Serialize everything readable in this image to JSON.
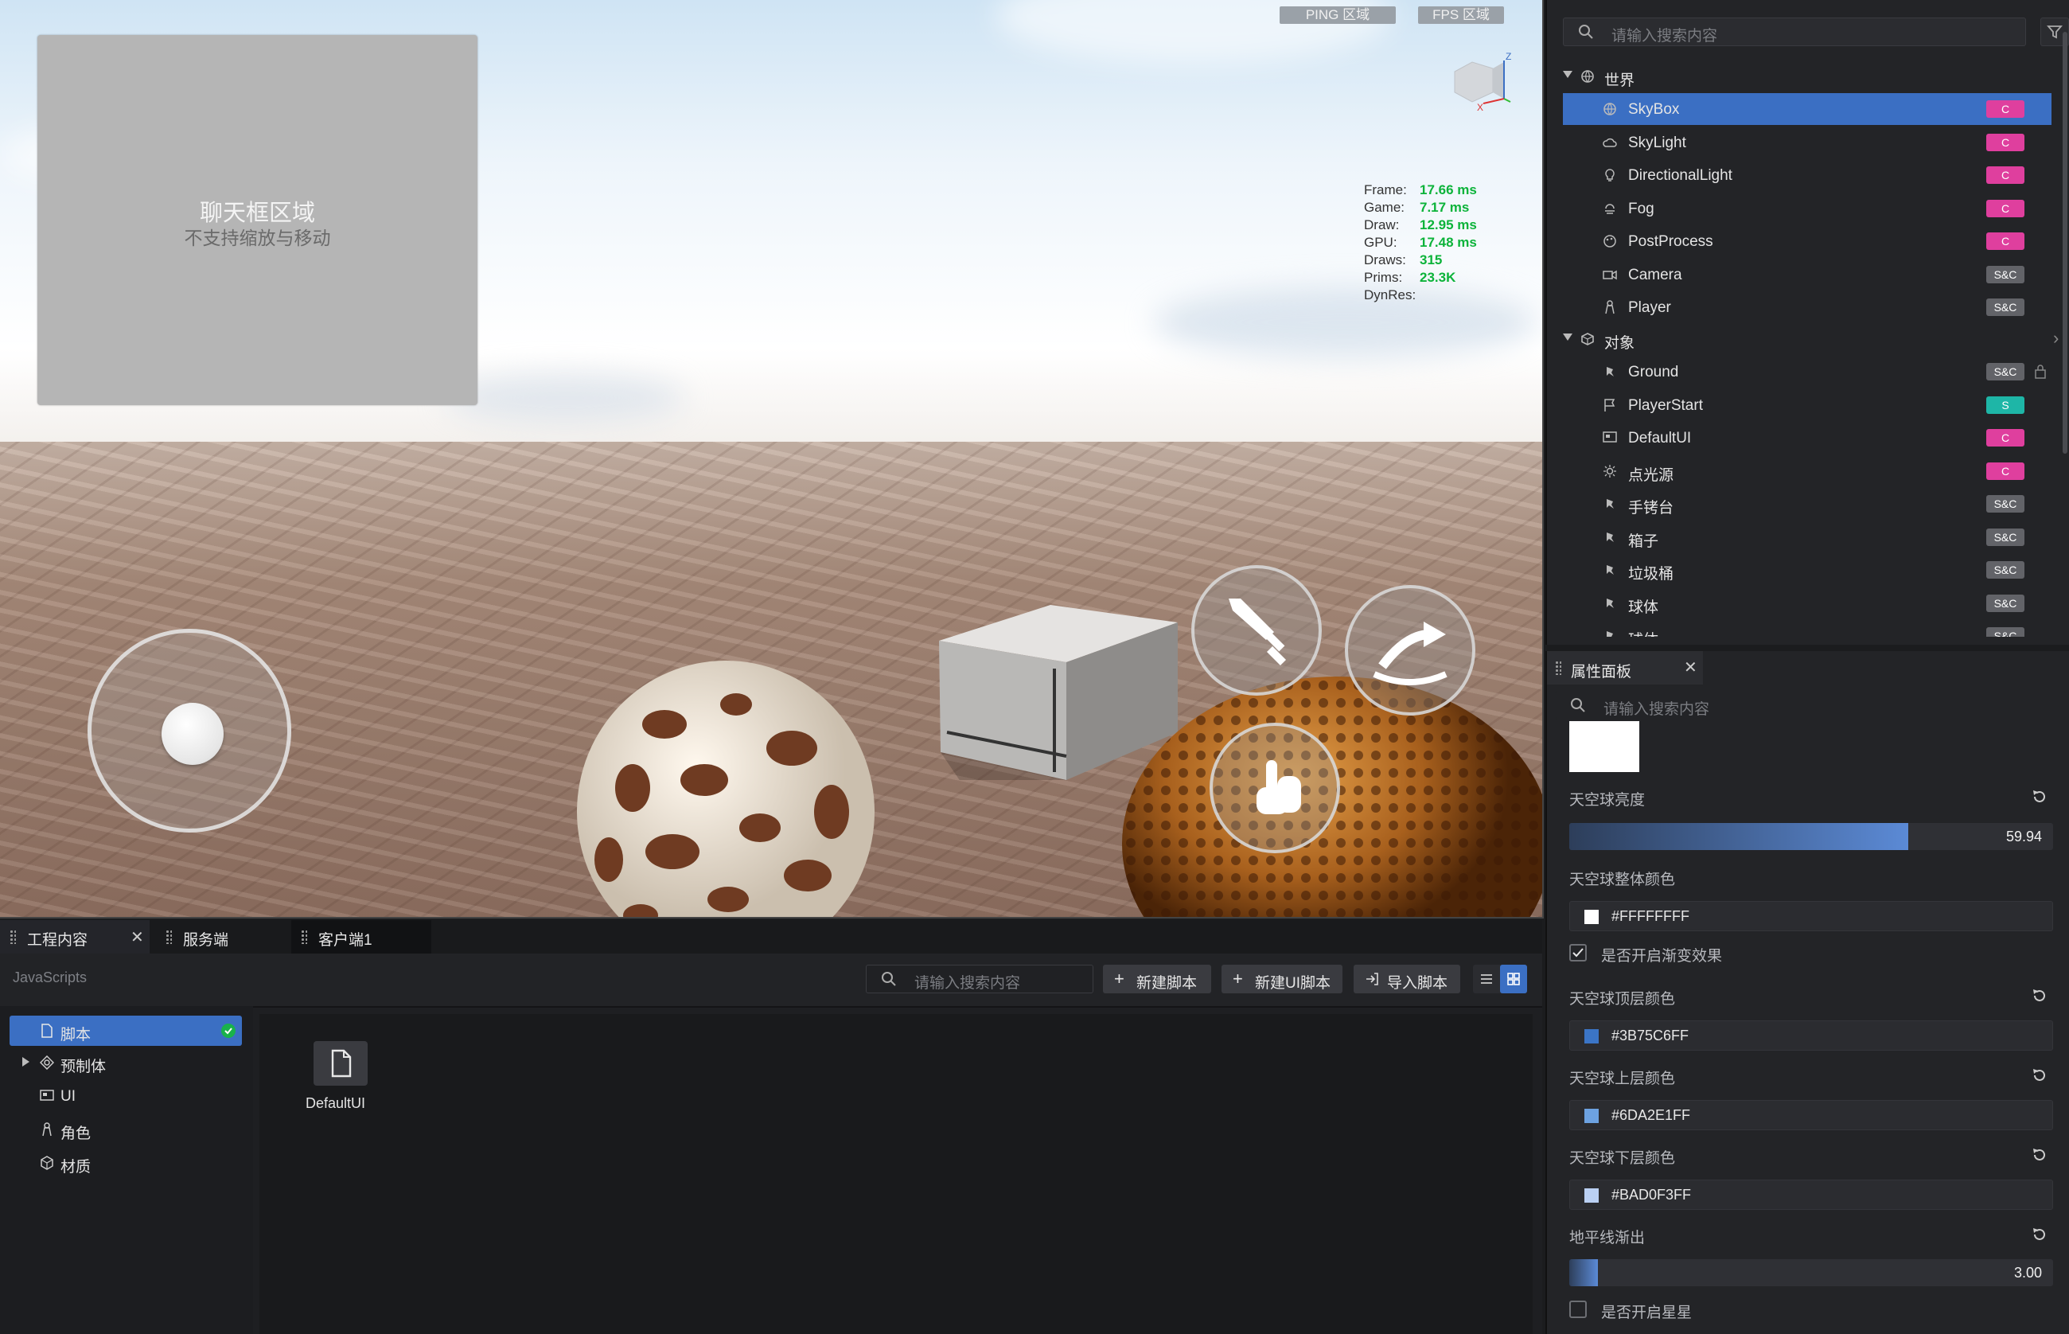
{
  "viewport": {
    "ping_label": "PING 区域",
    "fps_label": "FPS 区域",
    "chat_title": "聊天框区域",
    "chat_subtitle": "不支持缩放与移动",
    "stats": [
      {
        "k": "Frame:",
        "v": "17.66 ms"
      },
      {
        "k": "Game:",
        "v": "7.17 ms"
      },
      {
        "k": "Draw:",
        "v": "12.95 ms"
      },
      {
        "k": "GPU:",
        "v": "17.48 ms"
      },
      {
        "k": "Draws:",
        "v": "315"
      },
      {
        "k": "Prims:",
        "v": "23.3K"
      },
      {
        "k": "DynRes:",
        "v": ""
      }
    ],
    "gizmo_z": "Z",
    "gizmo_x": "X"
  },
  "outline": {
    "search_placeholder": "请输入搜索内容",
    "world_label": "世界",
    "objects_label": "对象",
    "world_items": [
      {
        "label": "SkyBox",
        "badge": "C",
        "icon": "globe-icon"
      },
      {
        "label": "SkyLight",
        "badge": "C",
        "icon": "cloud-icon"
      },
      {
        "label": "DirectionalLight",
        "badge": "C",
        "icon": "bulb-icon"
      },
      {
        "label": "Fog",
        "badge": "C",
        "icon": "fog-icon"
      },
      {
        "label": "PostProcess",
        "badge": "C",
        "icon": "palette-icon"
      },
      {
        "label": "Camera",
        "badge": "S&C",
        "icon": "camera-icon"
      },
      {
        "label": "Player",
        "badge": "S&C",
        "icon": "person-icon"
      }
    ],
    "object_items": [
      {
        "label": "Ground",
        "badge": "S&C",
        "icon": "model-icon"
      },
      {
        "label": "PlayerStart",
        "badge": "S",
        "icon": "flag-icon"
      },
      {
        "label": "DefaultUI",
        "badge": "C",
        "icon": "ui-icon"
      },
      {
        "label": "点光源",
        "badge": "C",
        "icon": "pointlight-icon"
      },
      {
        "label": "手铐台",
        "badge": "S&C",
        "icon": "model-icon"
      },
      {
        "label": "箱子",
        "badge": "S&C",
        "icon": "model-icon"
      },
      {
        "label": "垃圾桶",
        "badge": "S&C",
        "icon": "model-icon"
      },
      {
        "label": "球体",
        "badge": "S&C",
        "icon": "model-icon"
      },
      {
        "label": "球体",
        "badge": "S&C",
        "icon": "model-icon"
      }
    ]
  },
  "props": {
    "tab_label": "属性面板",
    "search_placeholder": "请输入搜索内容",
    "sky_brightness_label": "天空球亮度",
    "sky_brightness_value": "59.94",
    "sky_brightness_fraction": 0.7,
    "sky_color_label": "天空球整体颜色",
    "sky_color_hex": "#FFFFFFFF",
    "sky_color_swatch": "#FFFFFF",
    "gradient_label": "是否开启渐变效果",
    "top_color_label": "天空球顶层颜色",
    "top_color_hex": "#3B75C6FF",
    "top_color_swatch": "#3B75C6",
    "upper_color_label": "天空球上层颜色",
    "upper_color_hex": "#6DA2E1FF",
    "upper_color_swatch": "#6DA2E1",
    "lower_color_label": "天空球下层颜色",
    "lower_color_hex": "#BAD0F3FF",
    "lower_color_swatch": "#BAD0F3",
    "horizon_label": "地平线渐出",
    "horizon_value": "3.00",
    "horizon_fraction": 0.06,
    "stars_label": "是否开启星星"
  },
  "bottom": {
    "tabs": [
      "工程内容",
      "服务端",
      "客户端1"
    ],
    "path_label": "JavaScripts",
    "search_placeholder": "请输入搜索内容",
    "new_script": "新建脚本",
    "new_ui_script": "新建UI脚本",
    "import_script": "导入脚本",
    "sidebar": [
      {
        "label": "脚本",
        "icon": "file-icon"
      },
      {
        "label": "预制体",
        "icon": "prefab-icon"
      },
      {
        "label": "UI",
        "icon": "ui-icon"
      },
      {
        "label": "角色",
        "icon": "person-icon"
      },
      {
        "label": "材质",
        "icon": "cube-icon"
      }
    ],
    "file_name": "DefaultUI"
  },
  "colors": {
    "accent": "#3B6FC3",
    "badge_c": "#DF3F9E",
    "badge_sc": "#626368",
    "badge_s": "#1EB6A7",
    "stats_value": "#0CB33A"
  }
}
